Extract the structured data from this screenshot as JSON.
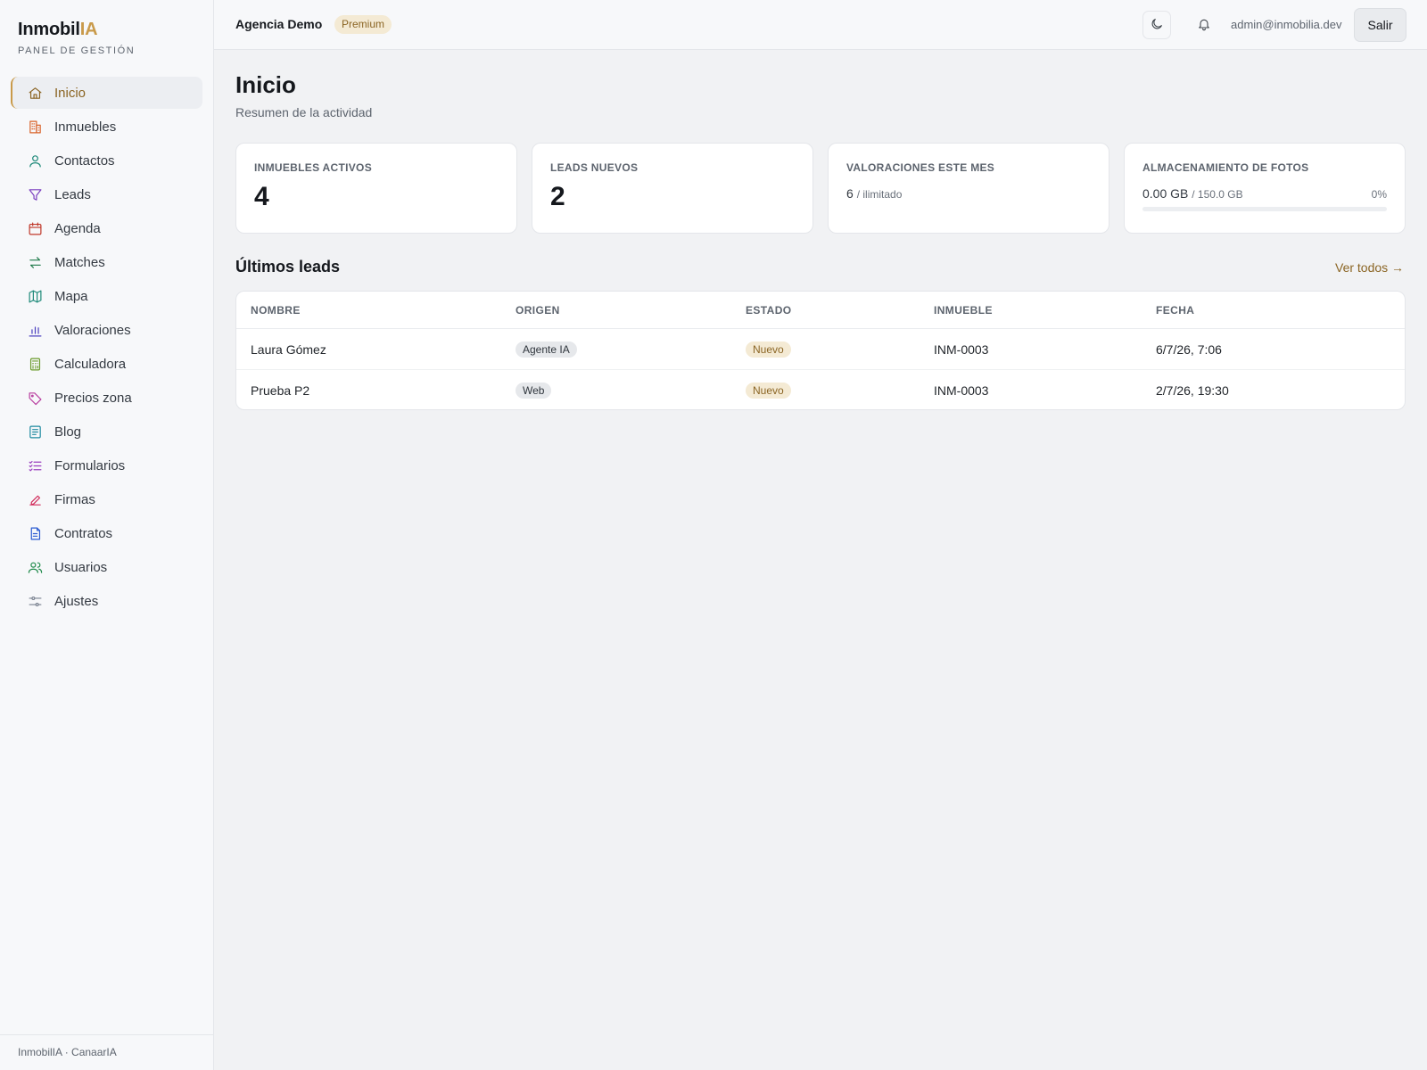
{
  "brand": {
    "name_main": "Inmobil",
    "name_accent": "IA",
    "subtitle": "PANEL DE GESTIÓN"
  },
  "sidebar": {
    "items": [
      {
        "label": "Inicio",
        "icon": "home-icon",
        "color": "#8b6524",
        "active": true
      },
      {
        "label": "Inmuebles",
        "icon": "building-icon",
        "color": "#d9642b"
      },
      {
        "label": "Contactos",
        "icon": "user-icon",
        "color": "#1f8a7a"
      },
      {
        "label": "Leads",
        "icon": "funnel-icon",
        "color": "#7b3fbf"
      },
      {
        "label": "Agenda",
        "icon": "calendar-icon",
        "color": "#c0392b"
      },
      {
        "label": "Matches",
        "icon": "arrows-icon",
        "color": "#1f7a4a"
      },
      {
        "label": "Mapa",
        "icon": "map-icon",
        "color": "#1f8a7a"
      },
      {
        "label": "Valoraciones",
        "icon": "bar-chart-icon",
        "color": "#4a3fbf"
      },
      {
        "label": "Calculadora",
        "icon": "calculator-icon",
        "color": "#6a9a2a"
      },
      {
        "label": "Precios zona",
        "icon": "tag-icon",
        "color": "#b83fa0"
      },
      {
        "label": "Blog",
        "icon": "article-icon",
        "color": "#1f8aa0"
      },
      {
        "label": "Formularios",
        "icon": "checklist-icon",
        "color": "#9a3fbf"
      },
      {
        "label": "Firmas",
        "icon": "pen-icon",
        "color": "#d12a5a"
      },
      {
        "label": "Contratos",
        "icon": "document-icon",
        "color": "#2a5ad1"
      },
      {
        "label": "Usuarios",
        "icon": "users-icon",
        "color": "#1f8a4a"
      },
      {
        "label": "Ajustes",
        "icon": "sliders-icon",
        "color": "#7a8290"
      }
    ],
    "footer": "InmobilIA · CanaarIA"
  },
  "topbar": {
    "agency": "Agencia Demo",
    "plan": "Premium",
    "email": "admin@inmobilia.dev",
    "logout": "Salir"
  },
  "main": {
    "title": "Inicio",
    "subtitle": "Resumen de la actividad",
    "stats": {
      "active_properties": {
        "label": "INMUEBLES ACTIVOS",
        "value": "4"
      },
      "new_leads": {
        "label": "LEADS NUEVOS",
        "value": "2"
      },
      "valuations": {
        "label": "VALORACIONES ESTE MES",
        "value": "6",
        "limit": "/ ilimitado"
      },
      "storage": {
        "label": "ALMACENAMIENTO DE FOTOS",
        "used": "0.00 GB",
        "total": "/ 150.0 GB",
        "percent": "0%",
        "fraction": 0
      }
    },
    "leads_section": {
      "title": "Últimos leads",
      "view_all": "Ver todos →",
      "headers": [
        "NOMBRE",
        "ORIGEN",
        "ESTADO",
        "INMUEBLE",
        "FECHA"
      ],
      "rows": [
        {
          "name": "Laura Gómez",
          "origin": "Agente IA",
          "status": "Nuevo",
          "property": "INM-0003",
          "date": "6/7/26, 7:06"
        },
        {
          "name": "Prueba P2",
          "origin": "Web",
          "status": "Nuevo",
          "property": "INM-0003",
          "date": "2/7/26, 19:30"
        }
      ]
    }
  },
  "colors": {
    "accent": "#c99a4a",
    "accent_text": "#8b6524"
  }
}
